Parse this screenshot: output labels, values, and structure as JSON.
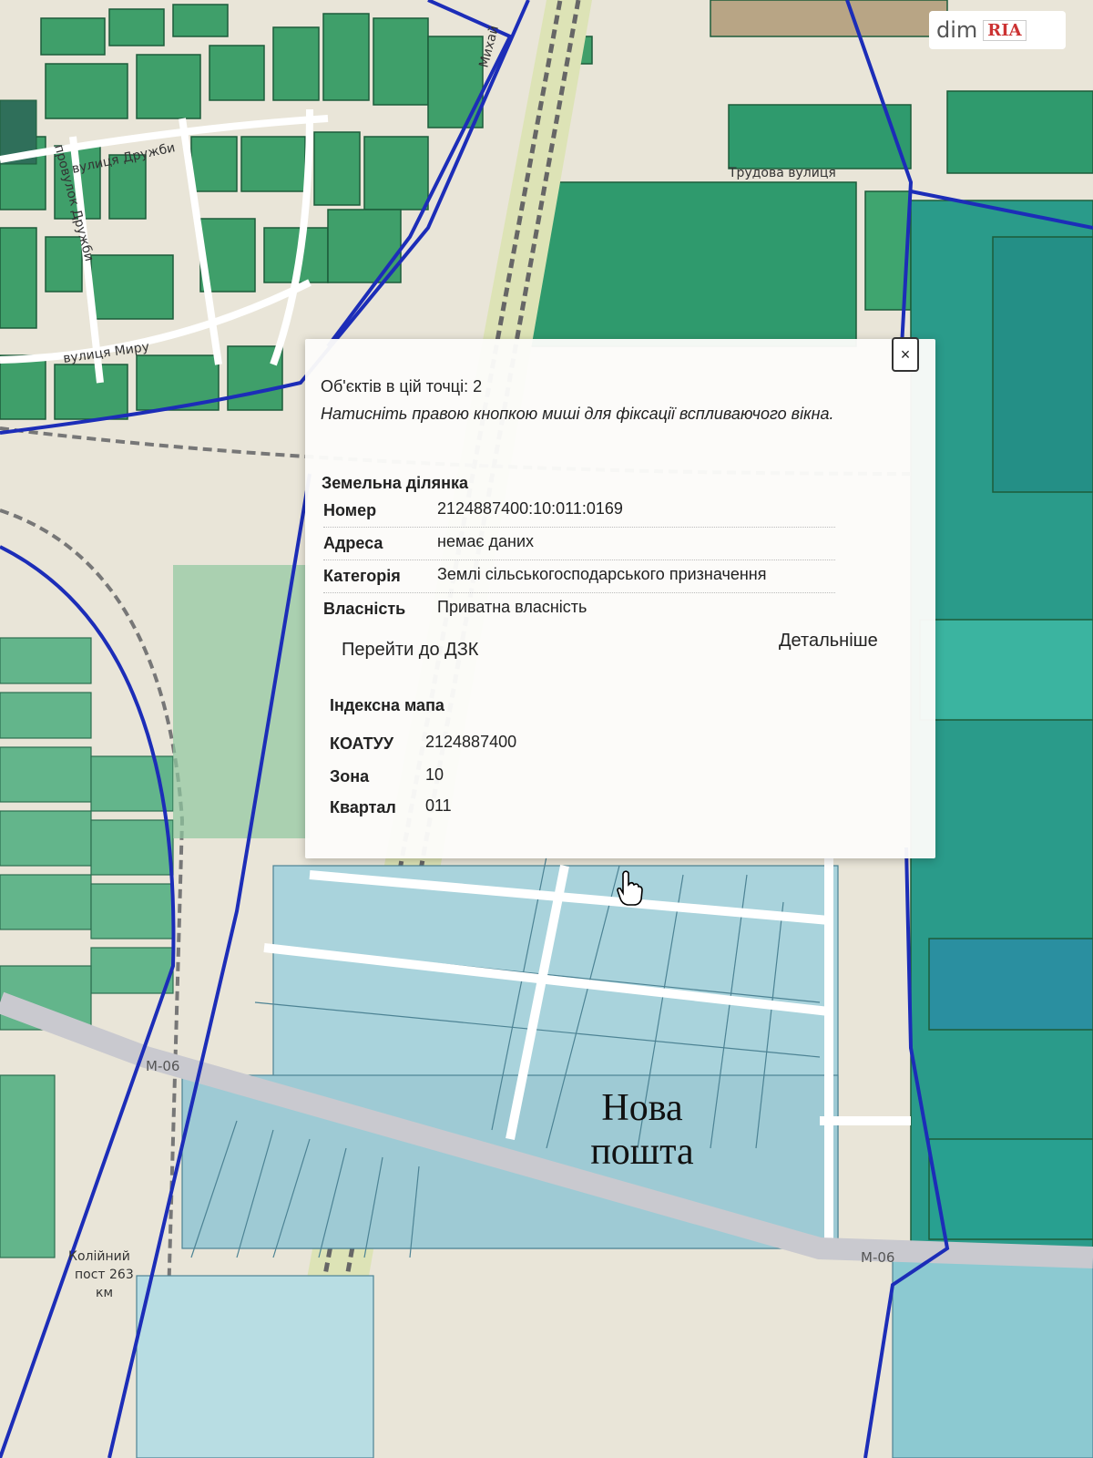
{
  "map": {
    "streets": [
      "вулиця Дружби",
      "провулок Дружби",
      "вулиця Миру",
      "Трудова вулиця",
      "Михай"
    ],
    "roads": [
      "М-06",
      "М-06"
    ],
    "station": {
      "line1": "Колійний",
      "line2": "пост 263",
      "line3": "км"
    },
    "annotation": {
      "line1": "Нова",
      "line2": "пошта"
    }
  },
  "watermark": {
    "dim": "dim",
    "ria": "RIA"
  },
  "popup": {
    "close": "×",
    "count": "Об'єктів в цій точці: 2",
    "hint": "Натисніть правою кнопкою миші для фіксації вспливаючого вікна.",
    "parcel_title": "Земельна ділянка",
    "parcel_rows": [
      {
        "key": "Номер",
        "value": "2124887400:10:011:0169"
      },
      {
        "key": "Адреса",
        "value": "немає даних"
      },
      {
        "key": "Категорія",
        "value": "Землі сільськогосподарського призначення"
      },
      {
        "key": "Власність",
        "value": "Приватна власність"
      }
    ],
    "goto_dzk": "Перейти до ДЗК",
    "details": "Детальніше",
    "index_title": "Індексна мапа",
    "index_rows": [
      {
        "key": "КОАТУУ",
        "value": "2124887400"
      },
      {
        "key": "Зона",
        "value": "10"
      },
      {
        "key": "Квартал",
        "value": "011"
      }
    ]
  }
}
